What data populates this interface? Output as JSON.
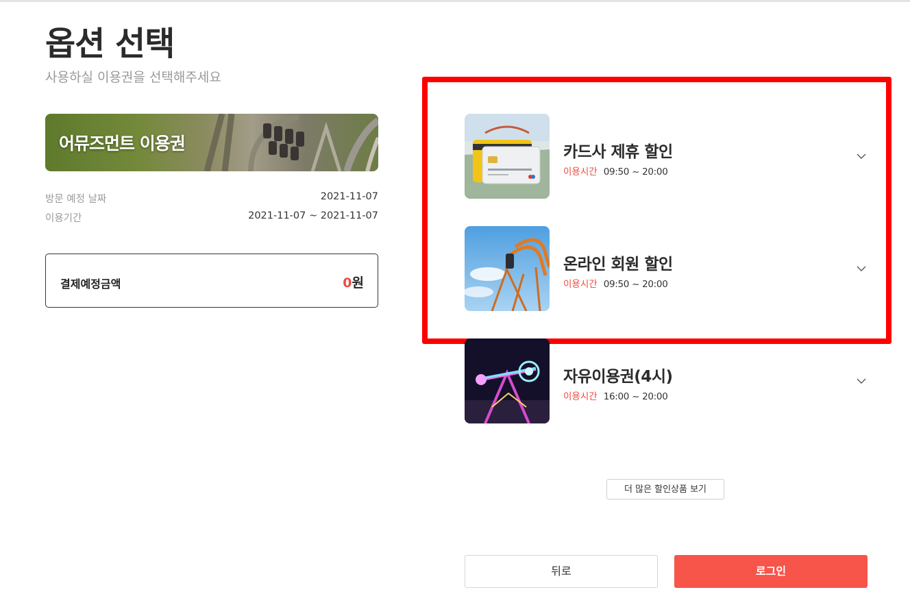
{
  "header": {
    "title": "옵션 선택",
    "subtitle": "사용하실 이용권을 선택해주세요"
  },
  "ticket": {
    "name": "어뮤즈먼트 이용권",
    "visit_date_label": "방문 예정 날짜",
    "visit_date": "2021-11-07",
    "period_label": "이용기간",
    "period": "2021-11-07 ~ 2021-11-07"
  },
  "payment": {
    "label": "결제예정금액",
    "amount": "0",
    "unit": "원"
  },
  "options": [
    {
      "title": "카드사 제휴 할인",
      "time_label": "이용시간",
      "time": "09:50 ~ 20:00",
      "icon": "chevron-down-icon"
    },
    {
      "title": "온라인 회원 할인",
      "time_label": "이용시간",
      "time": "09:50 ~ 20:00",
      "icon": "chevron-down-icon"
    },
    {
      "title": "자유이용권(4시)",
      "time_label": "이용시간",
      "time": "16:00 ~ 20:00",
      "icon": "chevron-down-icon"
    }
  ],
  "more_button": "더 많은 할인상품 보기",
  "footer": {
    "back_label": "뒤로",
    "login_label": "로그인"
  },
  "colors": {
    "accent": "#f04a3f",
    "login_button": "#f7544a",
    "highlight_border": "#ff0000"
  }
}
